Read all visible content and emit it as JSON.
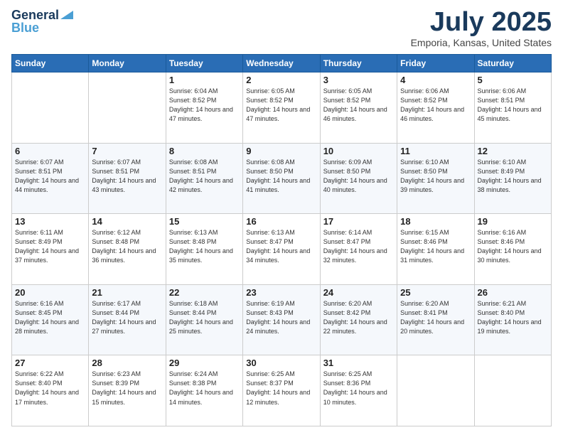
{
  "logo": {
    "line1": "General",
    "line2": "Blue"
  },
  "title": "July 2025",
  "subtitle": "Emporia, Kansas, United States",
  "days_of_week": [
    "Sunday",
    "Monday",
    "Tuesday",
    "Wednesday",
    "Thursday",
    "Friday",
    "Saturday"
  ],
  "weeks": [
    [
      {
        "day": "",
        "info": ""
      },
      {
        "day": "",
        "info": ""
      },
      {
        "day": "1",
        "info": "Sunrise: 6:04 AM\nSunset: 8:52 PM\nDaylight: 14 hours and 47 minutes."
      },
      {
        "day": "2",
        "info": "Sunrise: 6:05 AM\nSunset: 8:52 PM\nDaylight: 14 hours and 47 minutes."
      },
      {
        "day": "3",
        "info": "Sunrise: 6:05 AM\nSunset: 8:52 PM\nDaylight: 14 hours and 46 minutes."
      },
      {
        "day": "4",
        "info": "Sunrise: 6:06 AM\nSunset: 8:52 PM\nDaylight: 14 hours and 46 minutes."
      },
      {
        "day": "5",
        "info": "Sunrise: 6:06 AM\nSunset: 8:51 PM\nDaylight: 14 hours and 45 minutes."
      }
    ],
    [
      {
        "day": "6",
        "info": "Sunrise: 6:07 AM\nSunset: 8:51 PM\nDaylight: 14 hours and 44 minutes."
      },
      {
        "day": "7",
        "info": "Sunrise: 6:07 AM\nSunset: 8:51 PM\nDaylight: 14 hours and 43 minutes."
      },
      {
        "day": "8",
        "info": "Sunrise: 6:08 AM\nSunset: 8:51 PM\nDaylight: 14 hours and 42 minutes."
      },
      {
        "day": "9",
        "info": "Sunrise: 6:08 AM\nSunset: 8:50 PM\nDaylight: 14 hours and 41 minutes."
      },
      {
        "day": "10",
        "info": "Sunrise: 6:09 AM\nSunset: 8:50 PM\nDaylight: 14 hours and 40 minutes."
      },
      {
        "day": "11",
        "info": "Sunrise: 6:10 AM\nSunset: 8:50 PM\nDaylight: 14 hours and 39 minutes."
      },
      {
        "day": "12",
        "info": "Sunrise: 6:10 AM\nSunset: 8:49 PM\nDaylight: 14 hours and 38 minutes."
      }
    ],
    [
      {
        "day": "13",
        "info": "Sunrise: 6:11 AM\nSunset: 8:49 PM\nDaylight: 14 hours and 37 minutes."
      },
      {
        "day": "14",
        "info": "Sunrise: 6:12 AM\nSunset: 8:48 PM\nDaylight: 14 hours and 36 minutes."
      },
      {
        "day": "15",
        "info": "Sunrise: 6:13 AM\nSunset: 8:48 PM\nDaylight: 14 hours and 35 minutes."
      },
      {
        "day": "16",
        "info": "Sunrise: 6:13 AM\nSunset: 8:47 PM\nDaylight: 14 hours and 34 minutes."
      },
      {
        "day": "17",
        "info": "Sunrise: 6:14 AM\nSunset: 8:47 PM\nDaylight: 14 hours and 32 minutes."
      },
      {
        "day": "18",
        "info": "Sunrise: 6:15 AM\nSunset: 8:46 PM\nDaylight: 14 hours and 31 minutes."
      },
      {
        "day": "19",
        "info": "Sunrise: 6:16 AM\nSunset: 8:46 PM\nDaylight: 14 hours and 30 minutes."
      }
    ],
    [
      {
        "day": "20",
        "info": "Sunrise: 6:16 AM\nSunset: 8:45 PM\nDaylight: 14 hours and 28 minutes."
      },
      {
        "day": "21",
        "info": "Sunrise: 6:17 AM\nSunset: 8:44 PM\nDaylight: 14 hours and 27 minutes."
      },
      {
        "day": "22",
        "info": "Sunrise: 6:18 AM\nSunset: 8:44 PM\nDaylight: 14 hours and 25 minutes."
      },
      {
        "day": "23",
        "info": "Sunrise: 6:19 AM\nSunset: 8:43 PM\nDaylight: 14 hours and 24 minutes."
      },
      {
        "day": "24",
        "info": "Sunrise: 6:20 AM\nSunset: 8:42 PM\nDaylight: 14 hours and 22 minutes."
      },
      {
        "day": "25",
        "info": "Sunrise: 6:20 AM\nSunset: 8:41 PM\nDaylight: 14 hours and 20 minutes."
      },
      {
        "day": "26",
        "info": "Sunrise: 6:21 AM\nSunset: 8:40 PM\nDaylight: 14 hours and 19 minutes."
      }
    ],
    [
      {
        "day": "27",
        "info": "Sunrise: 6:22 AM\nSunset: 8:40 PM\nDaylight: 14 hours and 17 minutes."
      },
      {
        "day": "28",
        "info": "Sunrise: 6:23 AM\nSunset: 8:39 PM\nDaylight: 14 hours and 15 minutes."
      },
      {
        "day": "29",
        "info": "Sunrise: 6:24 AM\nSunset: 8:38 PM\nDaylight: 14 hours and 14 minutes."
      },
      {
        "day": "30",
        "info": "Sunrise: 6:25 AM\nSunset: 8:37 PM\nDaylight: 14 hours and 12 minutes."
      },
      {
        "day": "31",
        "info": "Sunrise: 6:25 AM\nSunset: 8:36 PM\nDaylight: 14 hours and 10 minutes."
      },
      {
        "day": "",
        "info": ""
      },
      {
        "day": "",
        "info": ""
      }
    ]
  ]
}
